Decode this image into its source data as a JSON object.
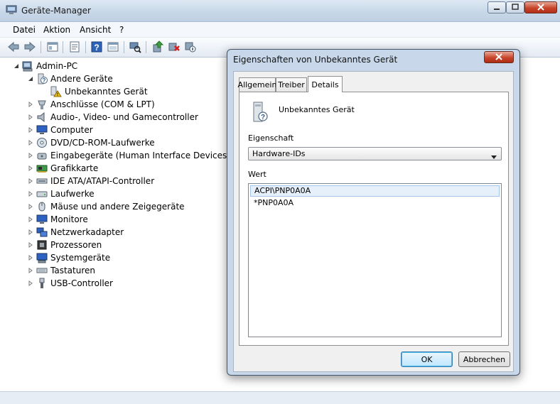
{
  "window": {
    "title": "Geräte-Manager",
    "menu": [
      "Datei",
      "Aktion",
      "Ansicht",
      "?"
    ]
  },
  "toolbar": {
    "icons": [
      "back-arrow-icon",
      "forward-arrow-icon",
      "up-folder-icon",
      "properties-icon",
      "help-icon",
      "show-hide-pane-icon",
      "scan-hardware-icon",
      "update-driver-icon",
      "uninstall-icon",
      "disable-device-icon"
    ]
  },
  "tree": {
    "root": "Admin-PC",
    "other_devices": "Andere Geräte",
    "unknown_device": "Unbekanntes Gerät",
    "categories": [
      "Anschlüsse (COM & LPT)",
      "Audio-, Video- und Gamecontroller",
      "Computer",
      "DVD/CD-ROM-Laufwerke",
      "Eingabegeräte (Human Interface Devices)",
      "Grafikkarte",
      "IDE ATA/ATAPI-Controller",
      "Laufwerke",
      "Mäuse und andere Zeigegeräte",
      "Monitore",
      "Netzwerkadapter",
      "Prozessoren",
      "Systemgeräte",
      "Tastaturen",
      "USB-Controller"
    ]
  },
  "dialog": {
    "title": "Eigenschaften von Unbekanntes Gerät",
    "tabs": [
      "Allgemein",
      "Treiber",
      "Details"
    ],
    "active_tab": "Details",
    "device_name": "Unbekanntes Gerät",
    "property_label": "Eigenschaft",
    "property_value": "Hardware-IDs",
    "value_label": "Wert",
    "values": [
      "ACPI\\PNP0A0A",
      "*PNP0A0A"
    ],
    "ok": "OK",
    "cancel": "Abbrechen"
  },
  "colors": {
    "title_gradient": "#c7d7e8",
    "close_red": "#c7452b",
    "selection": "#e5f0fb",
    "default_button": "#bee6fd"
  }
}
